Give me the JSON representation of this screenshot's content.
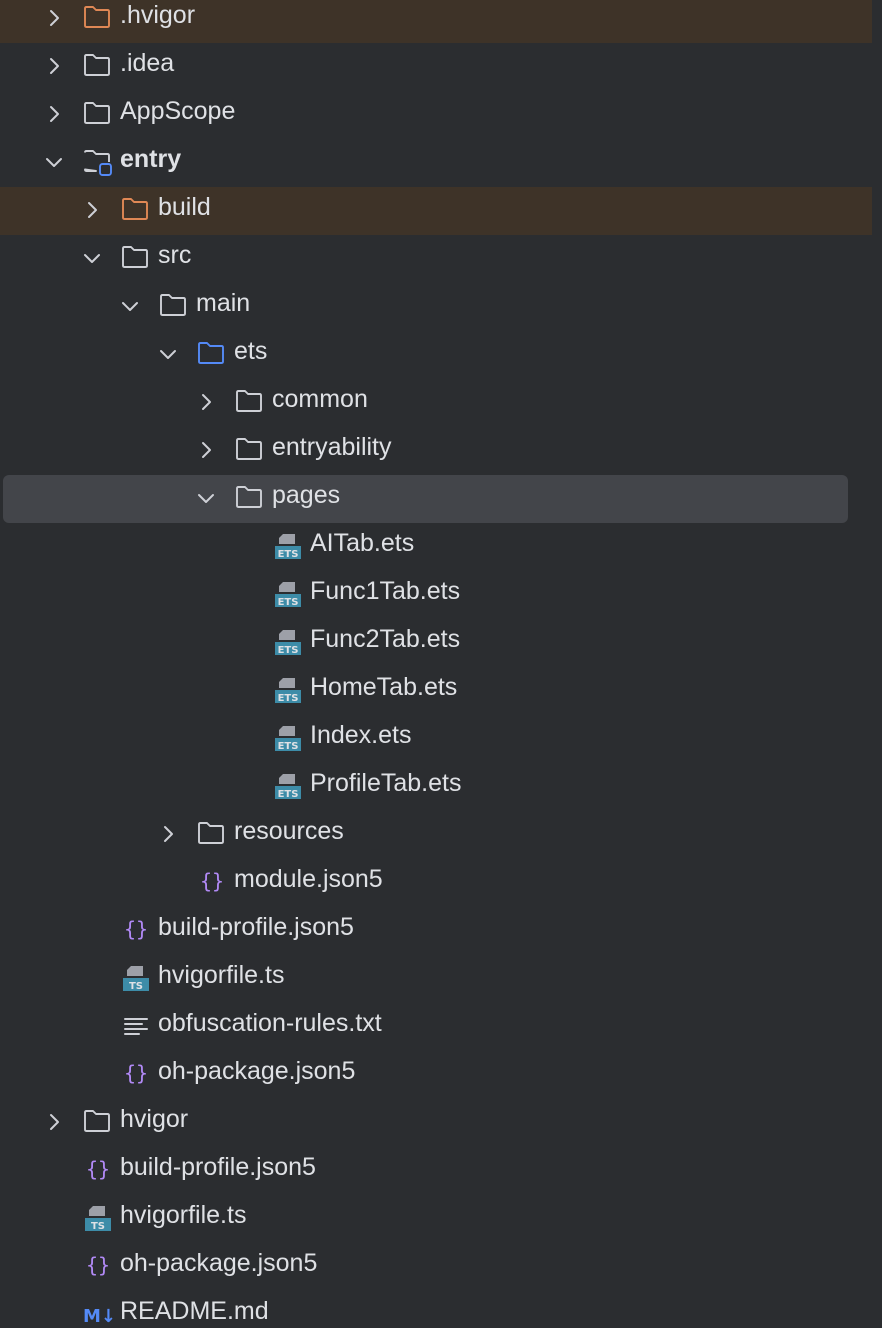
{
  "colors": {
    "background": "#2b2d30",
    "text": "#dfe1e5",
    "excluded_row": "#3e3328",
    "selected_row": "#43454a",
    "folder_default": "#ced0d6",
    "folder_excluded": "#e08855",
    "folder_source": "#548af7",
    "json_icon": "#b189f5",
    "ts_badge": "#3d8ca8"
  },
  "project_tree": {
    "items": [
      {
        "label": ".hvigor",
        "depth": 0,
        "chevron": "collapsed",
        "icon": "folder-excluded-icon",
        "excluded": true
      },
      {
        "label": ".idea",
        "depth": 0,
        "chevron": "collapsed",
        "icon": "folder-icon"
      },
      {
        "label": "AppScope",
        "depth": 0,
        "chevron": "collapsed",
        "icon": "folder-icon"
      },
      {
        "label": "entry",
        "depth": 0,
        "chevron": "expanded",
        "icon": "module-folder-icon",
        "bold": true
      },
      {
        "label": "build",
        "depth": 1,
        "chevron": "collapsed",
        "icon": "folder-excluded-icon",
        "excluded": true
      },
      {
        "label": "src",
        "depth": 1,
        "chevron": "expanded",
        "icon": "folder-icon"
      },
      {
        "label": "main",
        "depth": 2,
        "chevron": "expanded",
        "icon": "folder-icon"
      },
      {
        "label": "ets",
        "depth": 3,
        "chevron": "expanded",
        "icon": "source-folder-icon"
      },
      {
        "label": "common",
        "depth": 4,
        "chevron": "collapsed",
        "icon": "folder-icon"
      },
      {
        "label": "entryability",
        "depth": 4,
        "chevron": "collapsed",
        "icon": "folder-icon"
      },
      {
        "label": "pages",
        "depth": 4,
        "chevron": "expanded",
        "icon": "folder-icon",
        "selected": true
      },
      {
        "label": "AITab.ets",
        "depth": 5,
        "chevron": "none",
        "icon": "ets-file-icon",
        "badge": "ETS"
      },
      {
        "label": "Func1Tab.ets",
        "depth": 5,
        "chevron": "none",
        "icon": "ets-file-icon",
        "badge": "ETS"
      },
      {
        "label": "Func2Tab.ets",
        "depth": 5,
        "chevron": "none",
        "icon": "ets-file-icon",
        "badge": "ETS"
      },
      {
        "label": "HomeTab.ets",
        "depth": 5,
        "chevron": "none",
        "icon": "ets-file-icon",
        "badge": "ETS"
      },
      {
        "label": "Index.ets",
        "depth": 5,
        "chevron": "none",
        "icon": "ets-file-icon",
        "badge": "ETS"
      },
      {
        "label": "ProfileTab.ets",
        "depth": 5,
        "chevron": "none",
        "icon": "ets-file-icon",
        "badge": "ETS"
      },
      {
        "label": "resources",
        "depth": 3,
        "chevron": "collapsed",
        "icon": "folder-icon"
      },
      {
        "label": "module.json5",
        "depth": 3,
        "chevron": "none",
        "icon": "json-file-icon"
      },
      {
        "label": "build-profile.json5",
        "depth": 1,
        "chevron": "none",
        "icon": "json-file-icon"
      },
      {
        "label": "hvigorfile.ts",
        "depth": 1,
        "chevron": "none",
        "icon": "ts-file-icon",
        "badge": "TS"
      },
      {
        "label": "obfuscation-rules.txt",
        "depth": 1,
        "chevron": "none",
        "icon": "text-file-icon"
      },
      {
        "label": "oh-package.json5",
        "depth": 1,
        "chevron": "none",
        "icon": "json-file-icon"
      },
      {
        "label": "hvigor",
        "depth": 0,
        "chevron": "collapsed",
        "icon": "folder-icon"
      },
      {
        "label": "build-profile.json5",
        "depth": 0,
        "chevron": "none",
        "icon": "json-file-icon"
      },
      {
        "label": "hvigorfile.ts",
        "depth": 0,
        "chevron": "none",
        "icon": "ts-file-icon",
        "badge": "TS"
      },
      {
        "label": "oh-package.json5",
        "depth": 0,
        "chevron": "none",
        "icon": "json-file-icon"
      },
      {
        "label": "README.md",
        "depth": 0,
        "chevron": "none",
        "icon": "markdown-file-icon",
        "badge": "M↓"
      }
    ]
  }
}
